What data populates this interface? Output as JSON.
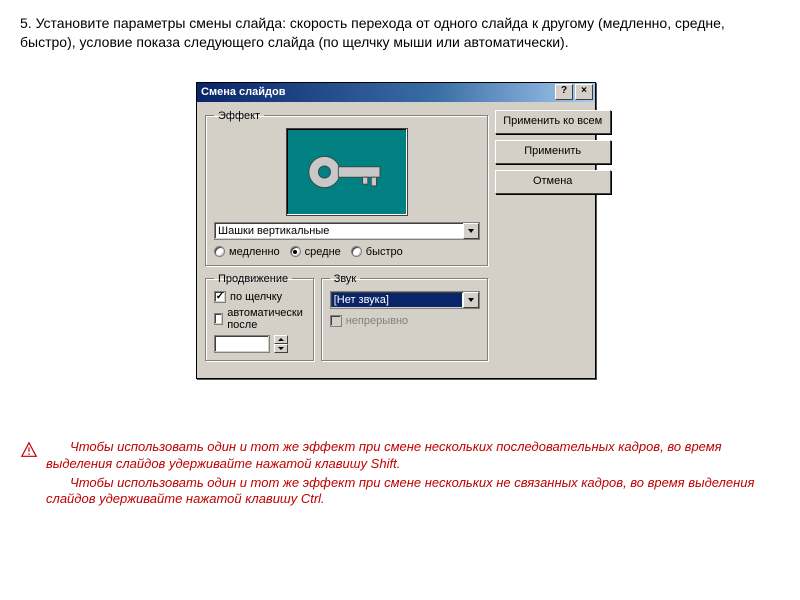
{
  "instructions": "5.  Установите параметры смены слайда: скорость перехода от одного слайда к другому (медленно, средне, быстро), условие показа следующего слайда (по щелчку мыши или автоматически).",
  "dialog": {
    "title": "Смена слайдов",
    "help_btn": "?",
    "close_btn": "×",
    "effect": {
      "legend": "Эффект",
      "combo_value": "Шашки вертикальные",
      "speed": {
        "slow": "медленно",
        "medium": "средне",
        "fast": "быстро",
        "selected": "medium"
      }
    },
    "buttons": {
      "apply_all": "Применить ко всем",
      "apply": "Применить",
      "cancel": "Отмена"
    },
    "advance": {
      "legend": "Продвижение",
      "on_click": "по щелчку",
      "on_click_checked": true,
      "auto_after": "автоматически после",
      "auto_after_checked": false,
      "auto_value": ""
    },
    "sound": {
      "legend": "Звук",
      "combo_value": "[Нет звука]",
      "loop": "непрерывно",
      "loop_checked": false
    }
  },
  "note": {
    "p1": "Чтобы использовать один и тот же эффект при смене нескольких последовательных кадров, во время выделения слайдов удерживайте нажатой клавишу Shift.",
    "p2": "Чтобы использовать один и тот же эффект при смене нескольких не связанных кадров, во время выделения слайдов удерживайте нажатой клавишу Ctrl."
  }
}
